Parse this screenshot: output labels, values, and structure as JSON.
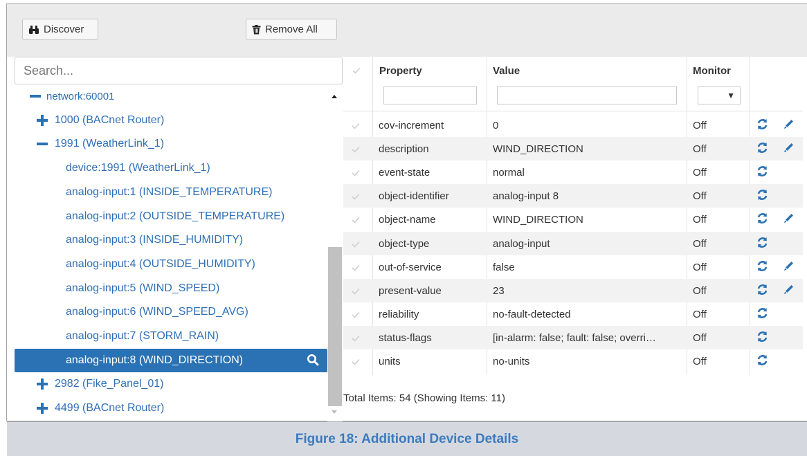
{
  "toolbar": {
    "discover_label": "Discover",
    "remove_all_label": "Remove All"
  },
  "search": {
    "placeholder": "Search..."
  },
  "tree": {
    "nodes": [
      {
        "label": "network:60001",
        "state": "collapse"
      },
      {
        "label": "1000 (BACnet Router)",
        "state": "expand"
      },
      {
        "label": "1991 (WeatherLink_1)",
        "state": "collapse"
      },
      {
        "label": "device:1991 (WeatherLink_1)",
        "state": "leaf"
      },
      {
        "label": "analog-input:1 (INSIDE_TEMPERATURE)",
        "state": "leaf"
      },
      {
        "label": "analog-input:2 (OUTSIDE_TEMPERATURE)",
        "state": "leaf"
      },
      {
        "label": "analog-input:3 (INSIDE_HUMIDITY)",
        "state": "leaf"
      },
      {
        "label": "analog-input:4 (OUTSIDE_HUMIDITY)",
        "state": "leaf"
      },
      {
        "label": "analog-input:5 (WIND_SPEED)",
        "state": "leaf"
      },
      {
        "label": "analog-input:6 (WIND_SPEED_AVG)",
        "state": "leaf"
      },
      {
        "label": "analog-input:7 (STORM_RAIN)",
        "state": "leaf"
      },
      {
        "label": "analog-input:8 (WIND_DIRECTION)",
        "state": "selected"
      },
      {
        "label": "2982 (Fike_Panel_01)",
        "state": "expand"
      },
      {
        "label": "4499 (BACnet Router)",
        "state": "expand"
      }
    ]
  },
  "table": {
    "headers": {
      "property": "Property",
      "value": "Value",
      "monitor": "Monitor"
    },
    "rows": [
      {
        "property": "cov-increment",
        "value": "0",
        "monitor": "Off",
        "editable": true
      },
      {
        "property": "description",
        "value": "WIND_DIRECTION",
        "monitor": "Off",
        "editable": true
      },
      {
        "property": "event-state",
        "value": "normal",
        "monitor": "Off",
        "editable": false
      },
      {
        "property": "object-identifier",
        "value": "analog-input 8",
        "monitor": "Off",
        "editable": false
      },
      {
        "property": "object-name",
        "value": "WIND_DIRECTION",
        "monitor": "Off",
        "editable": true
      },
      {
        "property": "object-type",
        "value": "analog-input",
        "monitor": "Off",
        "editable": false
      },
      {
        "property": "out-of-service",
        "value": "false",
        "monitor": "Off",
        "editable": true
      },
      {
        "property": "present-value",
        "value": "23",
        "monitor": "Off",
        "editable": true
      },
      {
        "property": "reliability",
        "value": "no-fault-detected",
        "monitor": "Off",
        "editable": false
      },
      {
        "property": "status-flags",
        "value": "[in-alarm: false; fault: false; overri…",
        "monitor": "Off",
        "editable": false
      },
      {
        "property": "units",
        "value": "no-units",
        "monitor": "Off",
        "editable": false
      }
    ],
    "footer": "Total Items: 54 (Showing Items: 11)"
  },
  "caption": "Figure 18: Additional Device Details",
  "colors": {
    "accent": "#2a72b4",
    "link": "#2f6fb4",
    "caption_bg": "#d5d9df",
    "caption_text": "#3b7ac0"
  },
  "icons": {
    "discover": "binoculars-icon",
    "remove_all": "trash-icon",
    "collapse": "minus-icon",
    "expand": "plus-icon",
    "selected": "magnifier-icon",
    "refresh": "refresh-icon",
    "edit": "pencil-icon",
    "check": "checkmark-icon"
  }
}
